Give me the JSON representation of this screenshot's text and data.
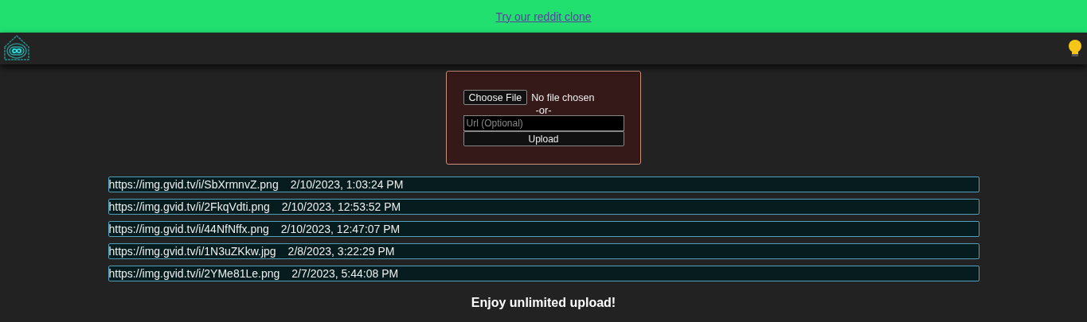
{
  "banner": {
    "link": "Try our reddit clone"
  },
  "upload_form": {
    "file_button": "Choose File",
    "file_status": "No file chosen",
    "separator": "-or-",
    "url_placeholder": "Url (Optional)",
    "upload_button": "Upload"
  },
  "uploads": [
    {
      "url": "https://img.gvid.tv/i/SbXrmnvZ.png",
      "date": "2/10/2023, 1:03:24 PM"
    },
    {
      "url": "https://img.gvid.tv/i/2FkqVdti.png",
      "date": "2/10/2023, 12:53:52 PM"
    },
    {
      "url": "https://img.gvid.tv/i/44NfNffx.png",
      "date": "2/10/2023, 12:47:07 PM"
    },
    {
      "url": "https://img.gvid.tv/i/1N3uZKkw.jpg",
      "date": "2/8/2023, 3:22:29 PM"
    },
    {
      "url": "https://img.gvid.tv/i/2YMe81Le.png",
      "date": "2/7/2023, 5:44:08 PM"
    }
  ],
  "footer": "Enjoy unlimited upload!"
}
